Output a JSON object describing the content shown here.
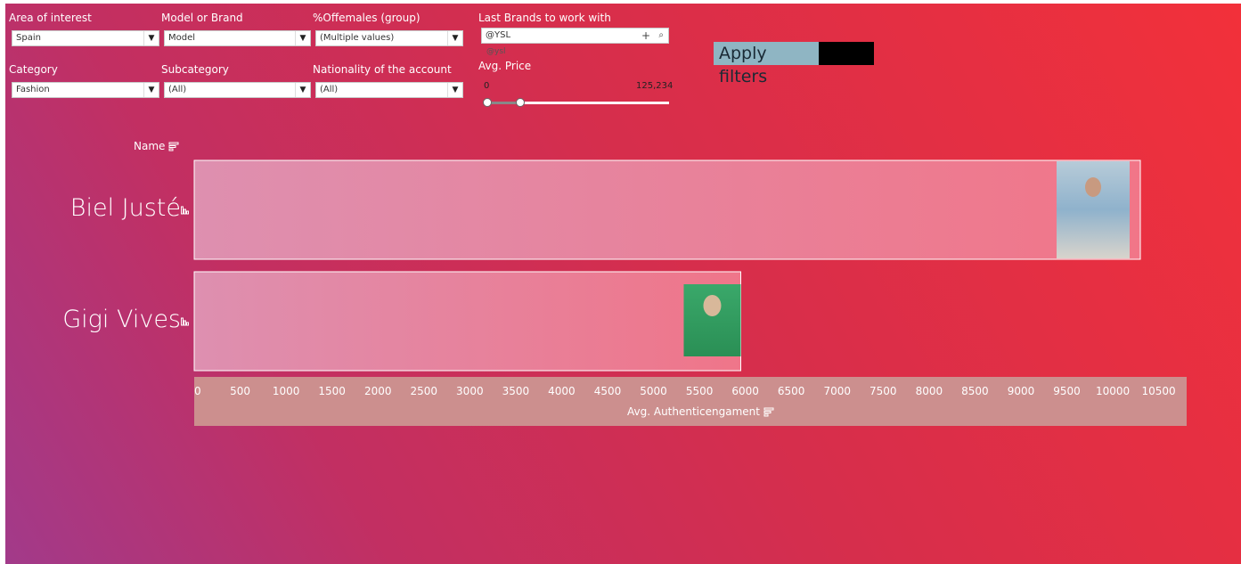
{
  "filters": {
    "area_label": "Area of interest",
    "area_value": "Spain",
    "model_label": "Model or Brand",
    "model_value": "Model",
    "females_label": "%Offemales (group)",
    "females_value": "(Multiple values)",
    "brands_label": "Last Brands to work with",
    "brands_value": "@YSL",
    "brands_hint": "@ysl",
    "category_label": "Category",
    "category_value": "Fashion",
    "subcategory_label": "Subcategory",
    "subcategory_value": "(All)",
    "nationality_label": "Nationality of the account",
    "nationality_value": "(All)",
    "price_label": "Avg. Price",
    "price_min": "0",
    "price_max": "125,234",
    "price_range": [
      0,
      125234
    ],
    "apply_label": "Apply filters"
  },
  "chart_data": {
    "type": "bar",
    "orientation": "horizontal",
    "row_header": "Name",
    "categories": [
      "Biel Justé",
      "Gigi Vives"
    ],
    "values": [
      10300,
      5950
    ],
    "xlabel": "Avg. Authenticengament",
    "xlim": [
      0,
      10800
    ],
    "xticks": [
      0,
      500,
      1000,
      1500,
      2000,
      2500,
      3000,
      3500,
      4000,
      4500,
      5000,
      5500,
      6000,
      6500,
      7000,
      7500,
      8000,
      8500,
      9000,
      9500,
      10000,
      10500
    ],
    "bar_colors": [
      "#e68ea7",
      "#f27a8e"
    ],
    "axis_band_color": "#cc8f8e",
    "grid": false
  }
}
